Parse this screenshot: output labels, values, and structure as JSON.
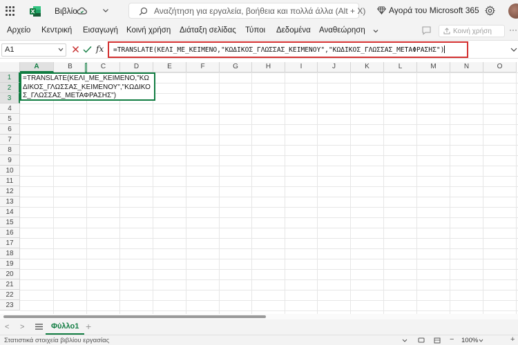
{
  "titlebar": {
    "app_name": "Βιβλίο",
    "search_placeholder": "Αναζήτηση για εργαλεία, βοήθεια και πολλά άλλα (Alt + X)",
    "m365_label": "Αγορά του Microsoft 365",
    "brand_color": "#107c41"
  },
  "ribbon": {
    "tabs": [
      "Αρχείο",
      "Κεντρική",
      "Εισαγωγή",
      "Κοινή χρήση",
      "Διάταξη σελίδας",
      "Τύποι",
      "Δεδομένα",
      "Αναθεώρηση"
    ],
    "share_label": "Κοινή χρήση",
    "more_label": "···"
  },
  "formula_bar": {
    "name_box": "A1",
    "fx_label": "fx",
    "formula": "=TRANSLATE(ΚΕΛΙ_ΜΕ_ΚΕΙΜΕΝΟ,\"ΚΩΔΙΚΟΣ_ΓΛΩΣΣΑΣ_ΚΕΙΜΕΝΟΥ\",\"ΚΩΔΙΚΟΣ_ΓΛΩΣΣΑΣ_ΜΕΤΑΦΡΑΣΗΣ\")",
    "highlight_color": "#d32f2f"
  },
  "grid": {
    "columns": [
      "A",
      "B",
      "C",
      "D",
      "E",
      "F",
      "G",
      "H",
      "I",
      "J",
      "K",
      "L",
      "M",
      "N",
      "O"
    ],
    "rows": [
      "1",
      "2",
      "3",
      "4",
      "5",
      "6",
      "7",
      "8",
      "9",
      "10",
      "11",
      "12",
      "13",
      "14",
      "15",
      "16",
      "17",
      "18",
      "19",
      "20",
      "21",
      "22",
      "23"
    ],
    "selected_column": "A",
    "active_cell_text": "=TRANSLATE(ΚΕΛΙ_ΜΕ_ΚΕΙΜΕΝΟ,\"ΚΩΔΙΚΟΣ_ΓΛΩΣΣΑΣ_ΚΕΙΜΕΝΟΥ\",\"ΚΩΔΙΚΟΣ_ΓΛΩΣΣΑΣ_ΜΕΤΑΦΡΑΣΗΣ\")"
  },
  "sheets": {
    "nav_prev": "<",
    "nav_next": ">",
    "active_sheet": "Φύλλο1",
    "add_label": "+"
  },
  "status": {
    "text": "Στατιστικά στοιχεία βιβλίου εργασίας",
    "zoom_minus": "−",
    "zoom": "100%",
    "zoom_plus": "+"
  }
}
